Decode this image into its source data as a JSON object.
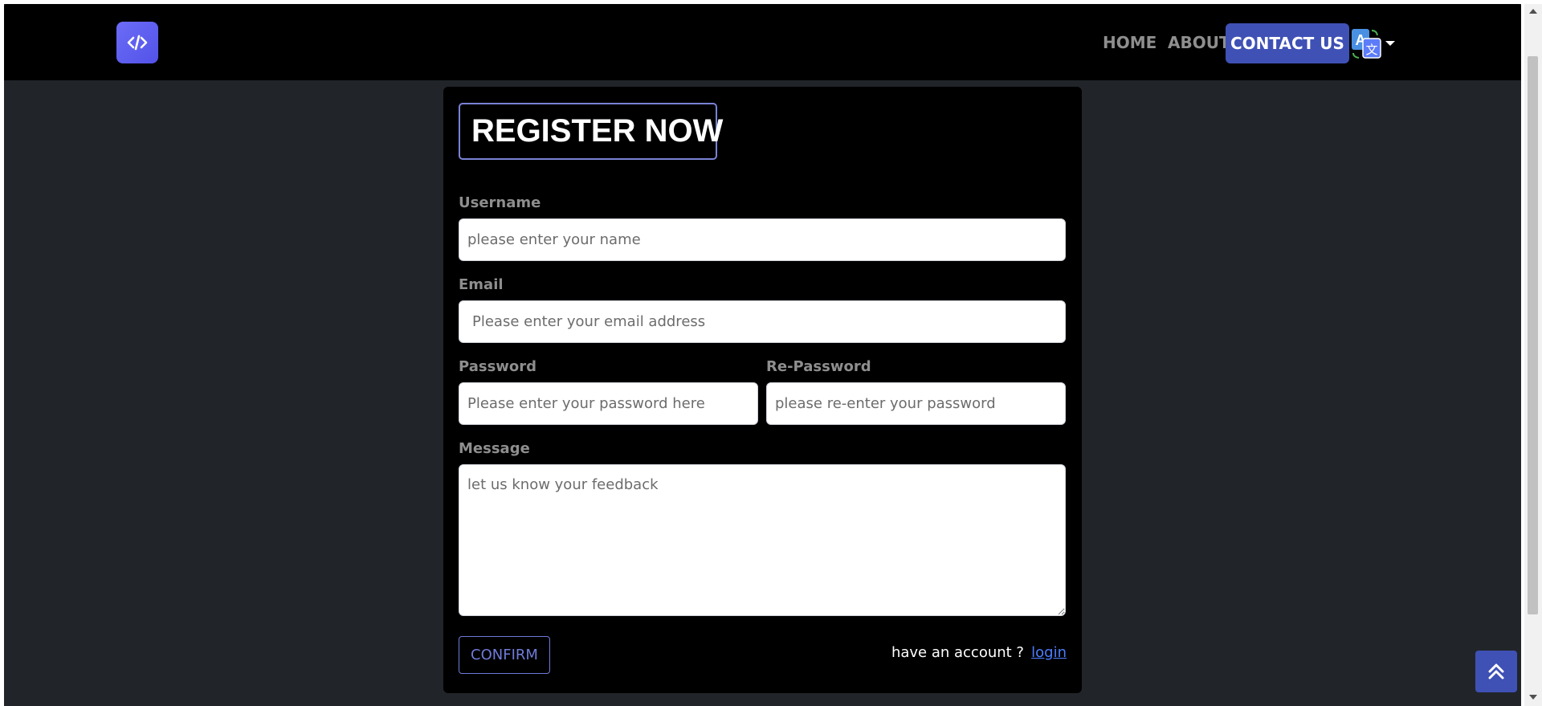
{
  "navbar": {
    "logo_icon": "code-icon",
    "links": {
      "home": "HOME",
      "about": "ABOUT",
      "contact": "CONTACT US"
    },
    "language_icon": "translate-icon",
    "accent_color": "#3f51b5"
  },
  "form": {
    "title": "REGISTER NOW",
    "username": {
      "label": "Username",
      "placeholder": "please enter your name"
    },
    "email": {
      "label": "Email",
      "placeholder": "Please enter your email address"
    },
    "password": {
      "label": "Password",
      "placeholder": "Please enter your password here"
    },
    "repassword": {
      "label": "Re-Password",
      "placeholder": "please re-enter your password"
    },
    "message": {
      "label": "Message",
      "placeholder": "let us know your feedback"
    },
    "confirm_label": "CONFIRM",
    "have_account_text": "have an account ?",
    "login_label": "login"
  },
  "scroll_top_icon": "double-chevron-up-icon"
}
